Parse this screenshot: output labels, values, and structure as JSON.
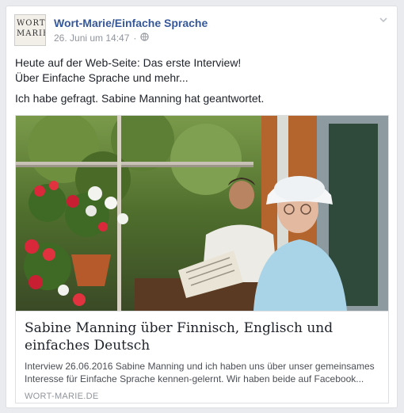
{
  "post": {
    "author": "Wort-Marie/Einfache Sprache",
    "avatar_text": "WORT MARIE",
    "timestamp": "26. Juni um 14:47",
    "separator": "·",
    "privacy_icon": "globe-icon",
    "menu_icon": "chevron-down-icon",
    "text_line1": "Heute auf der Web-Seite: Das erste Interview!",
    "text_line2": "Über Einfache Sprache und mehr...",
    "text_line3": "Ich habe gefragt. Sabine Manning hat geantwortet."
  },
  "link_preview": {
    "title": "Sabine Manning über Finnisch, Englisch und einfaches Deutsch",
    "description": "Interview 26.06.2016 Sabine Manning und ich haben uns über unser gemeinsames Interesse für Einfache Sprache kennen-gelernt. Wir haben beide auf Facebook...",
    "domain": "WORT-MARIE.DE"
  },
  "colors": {
    "link_blue": "#365899",
    "meta_gray": "#90949c",
    "text": "#1d2129"
  }
}
